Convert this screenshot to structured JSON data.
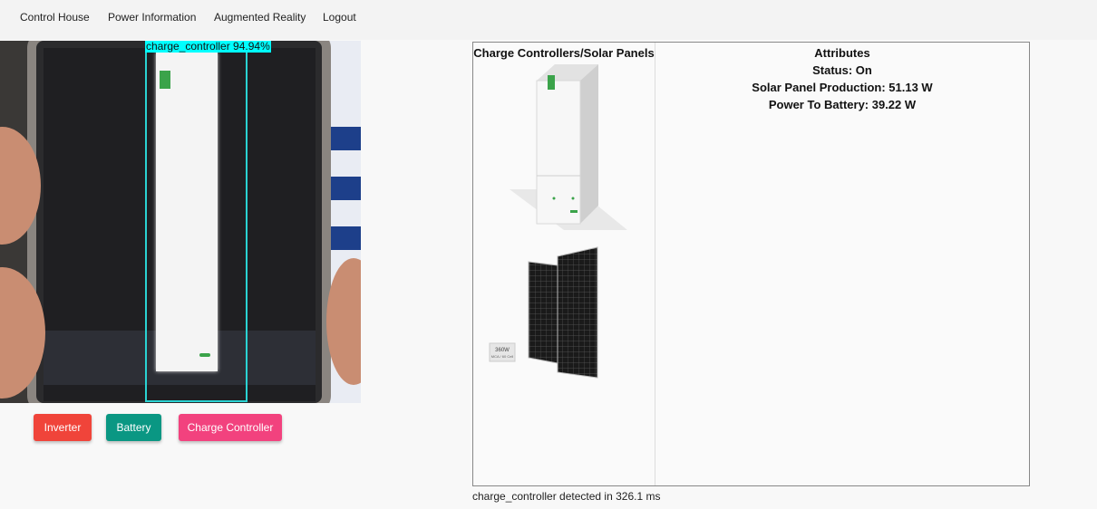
{
  "navbar": {
    "items": [
      {
        "label": "Control House"
      },
      {
        "label": "Power Information"
      },
      {
        "label": "Augmented Reality"
      },
      {
        "label": "Logout"
      }
    ]
  },
  "camera": {
    "detection_label": "charge_controller 94.94%"
  },
  "buttons": {
    "inverter": {
      "label": "Inverter",
      "color": "#f0443a"
    },
    "battery": {
      "label": "Battery",
      "color": "#0a9783"
    },
    "charge_controller": {
      "label": "Charge Controller",
      "color": "#f2427e"
    }
  },
  "table": {
    "image_header": "Charge Controllers/Solar Panels",
    "attributes_header": "Attributes",
    "status": "Status: On",
    "solar_production": "Solar Panel Production: 51.13 W",
    "power_to_battery": "Power To Battery: 39.22 W",
    "panel_tag": "360W",
    "panel_tag_sub": "MCA / 60 Cell"
  },
  "footer": {
    "status_text": "charge_controller detected in 326.1 ms"
  }
}
